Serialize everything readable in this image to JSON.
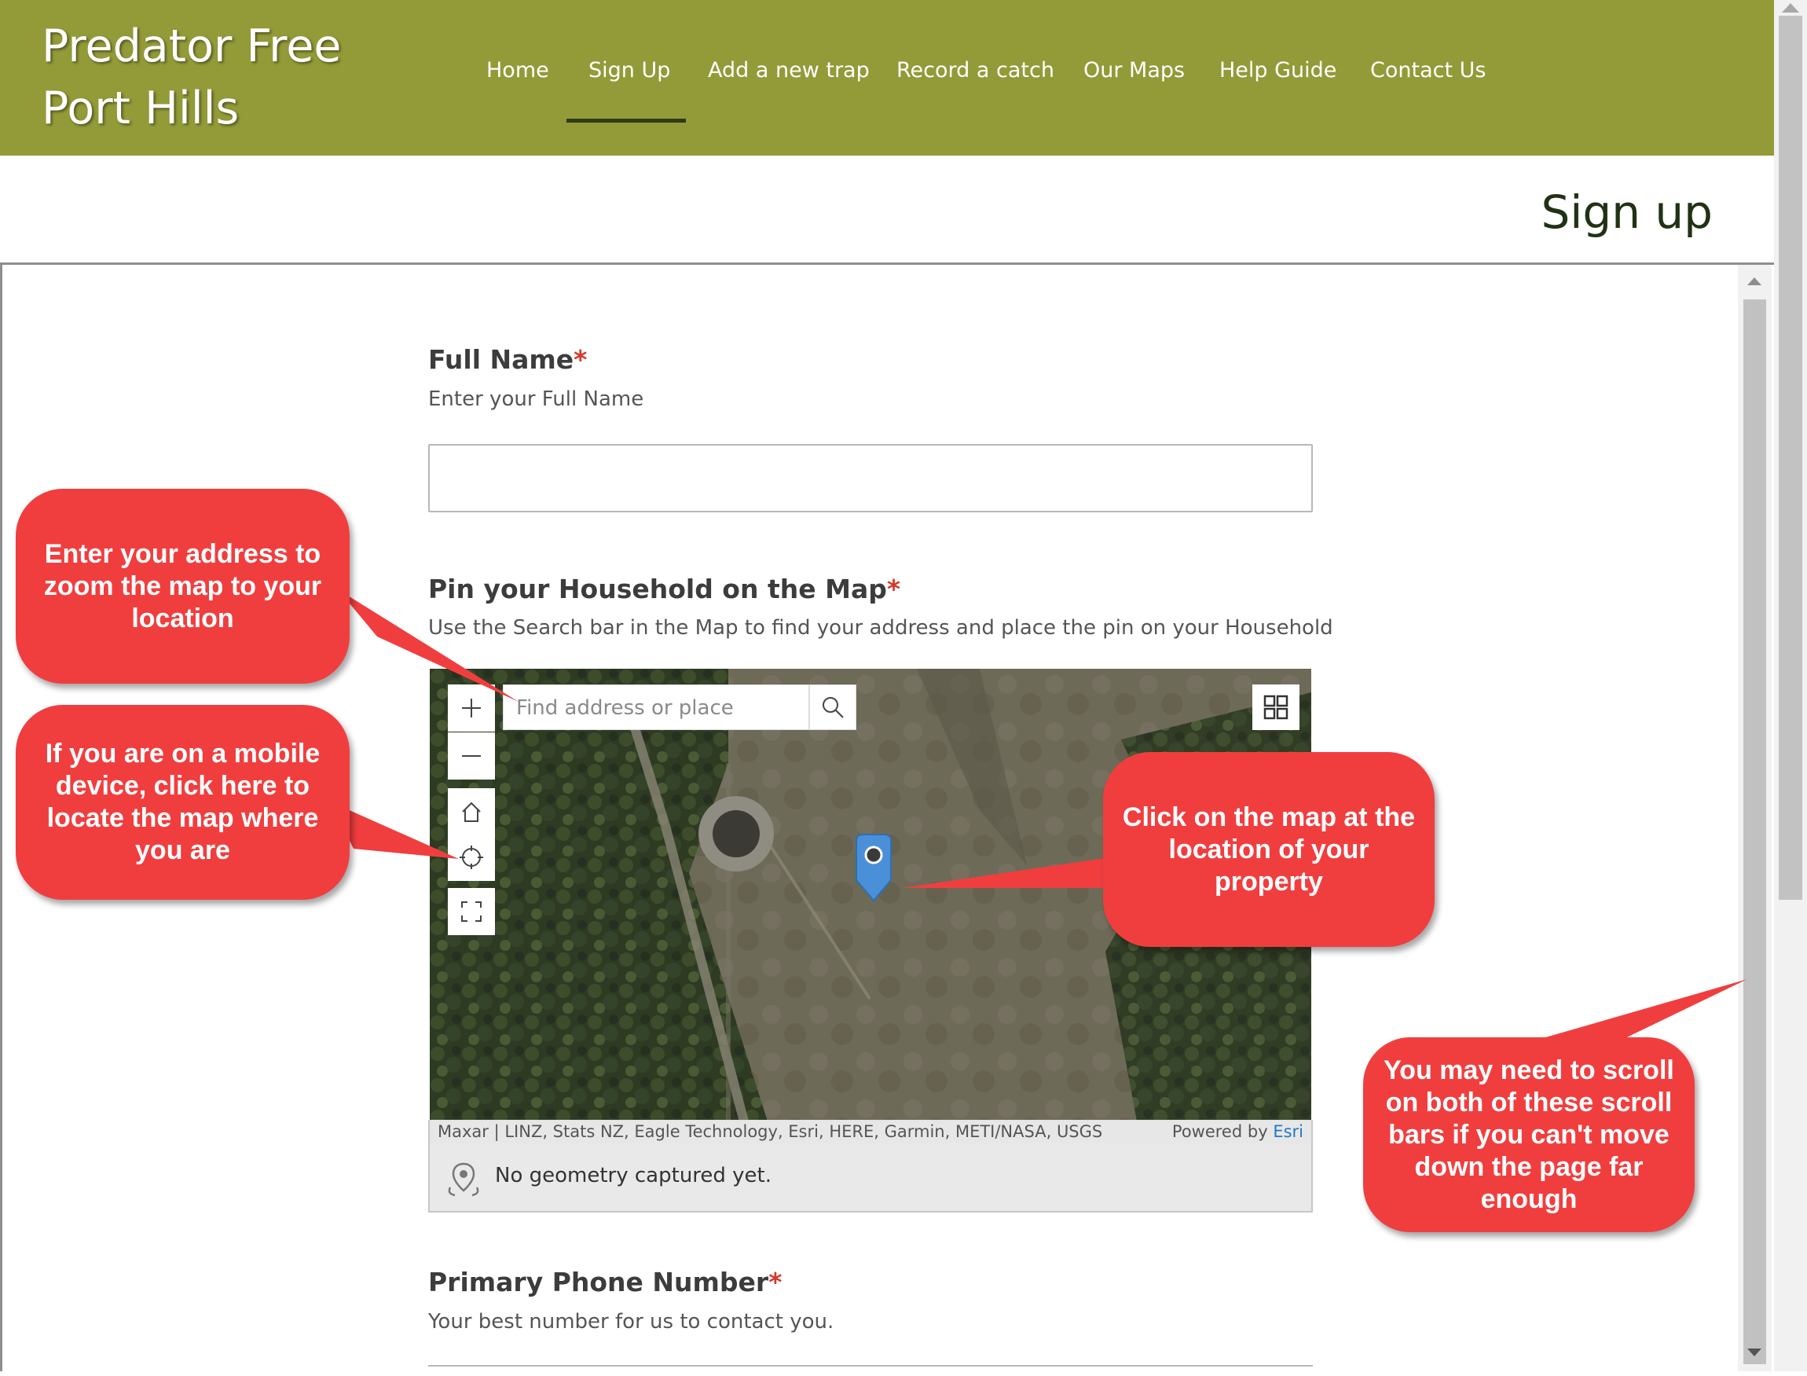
{
  "site": {
    "title": "Predator Free Port Hills"
  },
  "nav": {
    "items": [
      {
        "label": "Home"
      },
      {
        "label": "Sign Up"
      },
      {
        "label": "Add a new trap"
      },
      {
        "label": "Record a catch"
      },
      {
        "label": "Our Maps"
      },
      {
        "label": "Help Guide"
      },
      {
        "label": "Contact Us"
      }
    ],
    "active": "Sign Up"
  },
  "page": {
    "title": "Sign up"
  },
  "form": {
    "full_name": {
      "label": "Full Name",
      "required_mark": "*",
      "hint": "Enter your Full Name",
      "value": ""
    },
    "household_pin": {
      "label": "Pin your Household on the Map",
      "required_mark": "*",
      "hint": "Use the Search bar in the Map to find your address and place the pin on your Household"
    },
    "phone": {
      "label": "Primary Phone Number",
      "required_mark": "*",
      "hint": "Your best number for us to contact you."
    }
  },
  "map": {
    "search_placeholder": "Find address or place",
    "attribution": "Maxar | LINZ, Stats NZ, Eagle Technology, Esri, HERE, Garmin, METI/NASA, USGS",
    "powered_by": "Powered by",
    "powered_by_brand": "Esri",
    "status": "No geometry captured yet.",
    "controls": [
      "zoom-in",
      "zoom-out",
      "home",
      "locate",
      "fullscreen",
      "basemap-toggle",
      "search"
    ],
    "pin_color": "#4a90d9"
  },
  "callouts": {
    "search_tip": "Enter your address to zoom the map to your location",
    "locate_tip": "If you are on a mobile device, click here to locate the map where you are",
    "click_tip": "Click on the map at the location of your property",
    "scroll_tip": "You may need to scroll on both of these scroll bars if you can't move down the page far enough"
  },
  "colors": {
    "header_bg": "#939a38",
    "callout_bg": "#f03e3f",
    "required": "#d4392b",
    "nav_active_underline": "#2f3a17"
  }
}
